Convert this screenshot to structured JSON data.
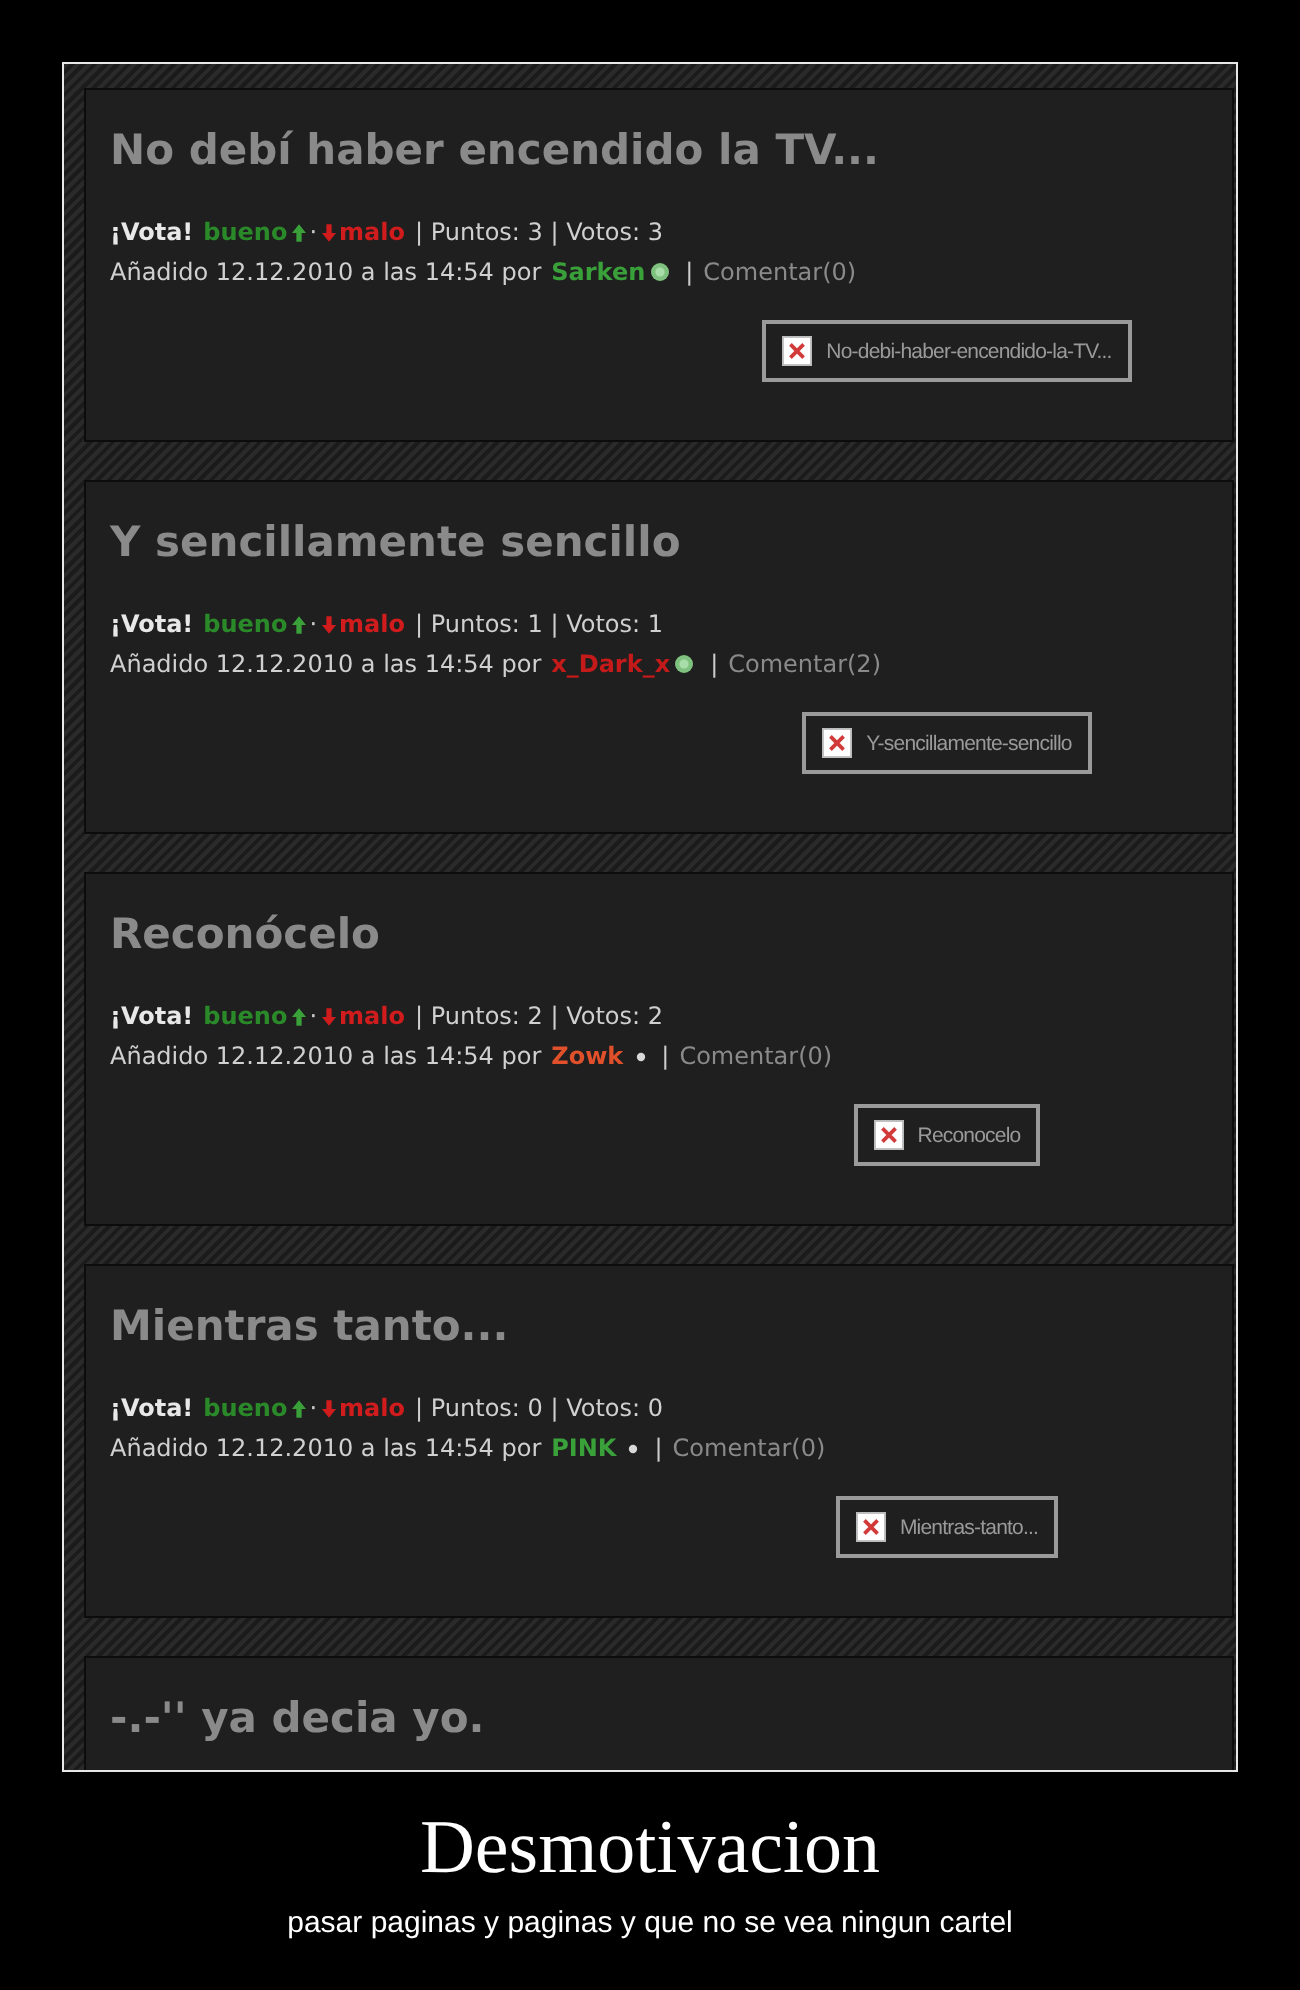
{
  "posts": [
    {
      "title": "No debí haber encendido la TV...",
      "vote_label": "¡Vota!",
      "good": "bueno",
      "dot": "·",
      "bad": "malo",
      "stats": "| Puntos: 3 | Votos: 3",
      "added": "Añadido 12.12.2010 a las 14:54 por",
      "author": "Sarken",
      "color": "#3aa03a",
      "online": true,
      "separator": "|",
      "comments": "Comentar(0)",
      "image_alt": "No-debi-haber-encendido-la-TV..."
    },
    {
      "title": "Y sencillamente sencillo",
      "vote_label": "¡Vota!",
      "good": "bueno",
      "dot": "·",
      "bad": "malo",
      "stats": "| Puntos: 1 | Votos: 1",
      "added": "Añadido 12.12.2010 a las 14:54 por",
      "author": "x_Dark_x",
      "color": "#c41a1a",
      "online": true,
      "separator": "|",
      "comments": "Comentar(2)",
      "image_alt": "Y-sencillamente-sencillo"
    },
    {
      "title": "Reconócelo",
      "vote_label": "¡Vota!",
      "good": "bueno",
      "dot": "·",
      "bad": "malo",
      "stats": "| Puntos: 2 | Votos: 2",
      "added": "Añadido 12.12.2010 a las 14:54 por",
      "author": "Zowk",
      "color": "#e0502a",
      "online": false,
      "separator": "|",
      "comments": "Comentar(0)",
      "image_alt": "Reconocelo"
    },
    {
      "title": "Mientras tanto...",
      "vote_label": "¡Vota!",
      "good": "bueno",
      "dot": "·",
      "bad": "malo",
      "stats": "| Puntos: 0 | Votos: 0",
      "added": "Añadido 12.12.2010 a las 14:54 por",
      "author": "PINK",
      "color": "#3aa03a",
      "online": false,
      "separator": "|",
      "comments": "Comentar(0)",
      "image_alt": "Mientras-tanto..."
    },
    {
      "title": "-.-'' ya decia yo."
    }
  ],
  "poster": {
    "title": "Desmotivacion",
    "caption": "pasar paginas y paginas y que no se vea ningun cartel"
  }
}
